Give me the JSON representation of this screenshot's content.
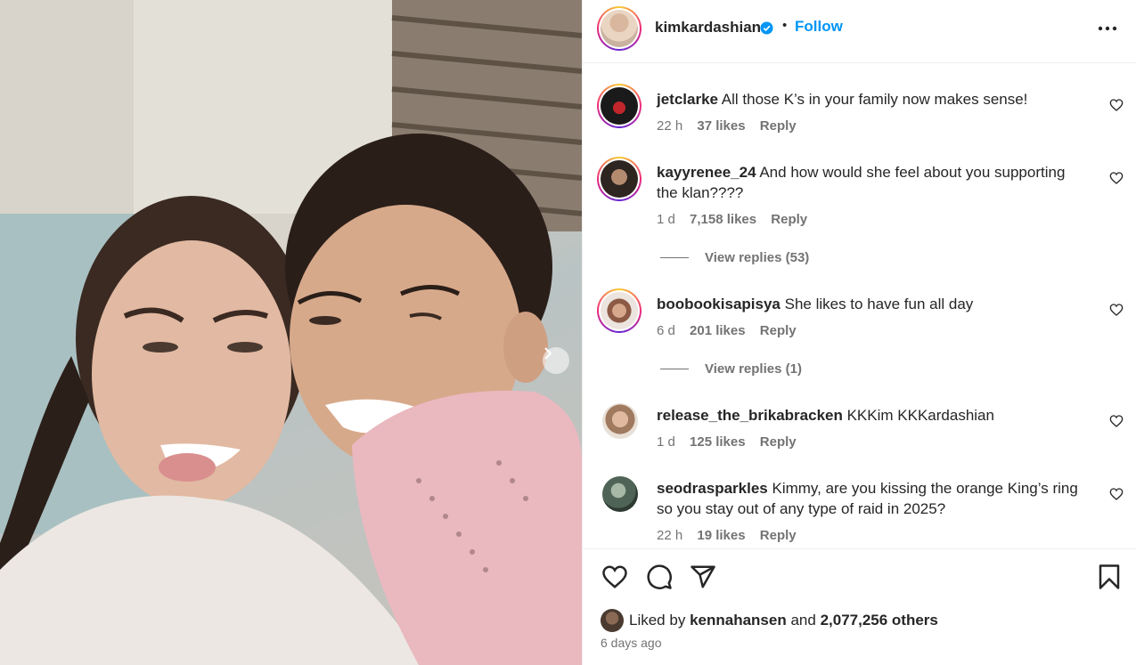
{
  "post": {
    "username": "kimkardashian",
    "follow_label": "Follow",
    "separator": "•"
  },
  "comments": [
    {
      "user": "jetclarke",
      "text": "All those K’s in your family now makes sense!",
      "time": "22 h",
      "likes": "37 likes",
      "reply": "Reply"
    },
    {
      "user": "kayyrenee_24",
      "text": "And how would she feel about you supporting the klan????",
      "time": "1 d",
      "likes": "7,158 likes",
      "reply": "Reply",
      "view_replies": "View replies (53)"
    },
    {
      "user": "boobookisapisya",
      "text": "She likes to have fun all day",
      "time": "6 d",
      "likes": "201 likes",
      "reply": "Reply",
      "view_replies": "View replies (1)"
    },
    {
      "user": "release_the_brikabracken",
      "text": "KKKim KKKardashian",
      "time": "1 d",
      "likes": "125 likes",
      "reply": "Reply"
    },
    {
      "user": "seodrasparkles",
      "text": "Kimmy, are you kissing the orange King’s ring so you stay out of any type of raid in 2025?",
      "time": "22 h",
      "likes": "19 likes",
      "reply": "Reply"
    }
  ],
  "likes_summary": {
    "prefix": "Liked by",
    "user": "kennahansen",
    "joiner": "and",
    "others": "2,077,256 others"
  },
  "time_ago": "6 days ago",
  "colors": {
    "accent": "#0095f6",
    "verified": "#0095f6",
    "text": "#262626",
    "muted": "#737373"
  },
  "icons": [
    "heart-icon",
    "comment-icon",
    "share-icon",
    "bookmark-icon",
    "more-icon",
    "verified-badge-icon",
    "chevron-right-icon"
  ]
}
